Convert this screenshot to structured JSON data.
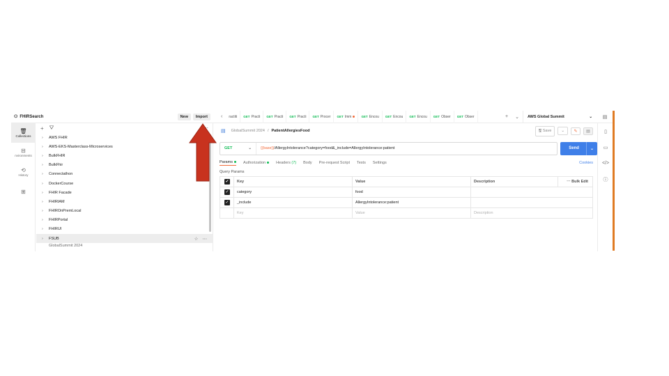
{
  "workspace": {
    "name": "FHIRSearch",
    "new_label": "New",
    "import_label": "Import"
  },
  "tabs": [
    {
      "method": "",
      "name": "ractiti"
    },
    {
      "method": "GET",
      "name": "Practi"
    },
    {
      "method": "GET",
      "name": "Practi"
    },
    {
      "method": "GET",
      "name": "Practi"
    },
    {
      "method": "GET",
      "name": "Procer"
    },
    {
      "method": "GET",
      "name": "Imm"
    },
    {
      "method": "GET",
      "name": "Encou"
    },
    {
      "method": "GET",
      "name": "Encou"
    },
    {
      "method": "GET",
      "name": "Encou"
    },
    {
      "method": "GET",
      "name": "Obser"
    },
    {
      "method": "GET",
      "name": "Obser"
    }
  ],
  "environment": "AWS Global Summit",
  "rail": [
    {
      "icon": "trash-icon",
      "label": "Collections"
    },
    {
      "icon": "environments-icon",
      "label": "nvironments"
    },
    {
      "icon": "history-icon",
      "label": "History"
    },
    {
      "icon": "apps-icon",
      "label": ""
    }
  ],
  "collections": [
    "AWS FHIR",
    "AWS-EKS-Masterclass-Microservices",
    "BulkFHIR",
    "BulkFhir",
    "Connectathon",
    "DockerCourse",
    "FHIR Facade",
    "FHIRIAM",
    "FHIROnPremLocal",
    "FHIRPortal",
    "FHIRUI",
    "FSUB"
  ],
  "collection_partial": "GlobalSummit 2024",
  "breadcrumb": {
    "parent": "GlobalSummit 2024",
    "separator": "/",
    "current": "PatientAllergiesFood"
  },
  "save_label": "Save",
  "request": {
    "method": "GET",
    "url_var": "{{base}}",
    "url_path": "/AllergyIntolerance?category=food&_include=AllergyIntolerance:patient",
    "send_label": "Send"
  },
  "subtabs": {
    "params": "Params",
    "authorization": "Authorization",
    "headers": "Headers",
    "headers_count": "(7)",
    "body": "Body",
    "prerequest": "Pre-request Script",
    "tests": "Tests",
    "settings": "Settings",
    "cookies": "Cookies"
  },
  "query_params": {
    "title": "Query Params",
    "headers": {
      "key": "Key",
      "value": "Value",
      "description": "Description",
      "bulk": "Bulk Edit"
    },
    "rows": [
      {
        "key": "category",
        "value": "food",
        "description": ""
      },
      {
        "key": "_include",
        "value": "AllergyIntolerance:patient",
        "description": ""
      }
    ],
    "placeholder": {
      "key": "Key",
      "value": "Value",
      "description": "Description"
    }
  },
  "colors": {
    "accent": "#f26b3a",
    "send": "#3f7fe8",
    "get": "#0cbb52",
    "arrow": "#c8321e"
  }
}
